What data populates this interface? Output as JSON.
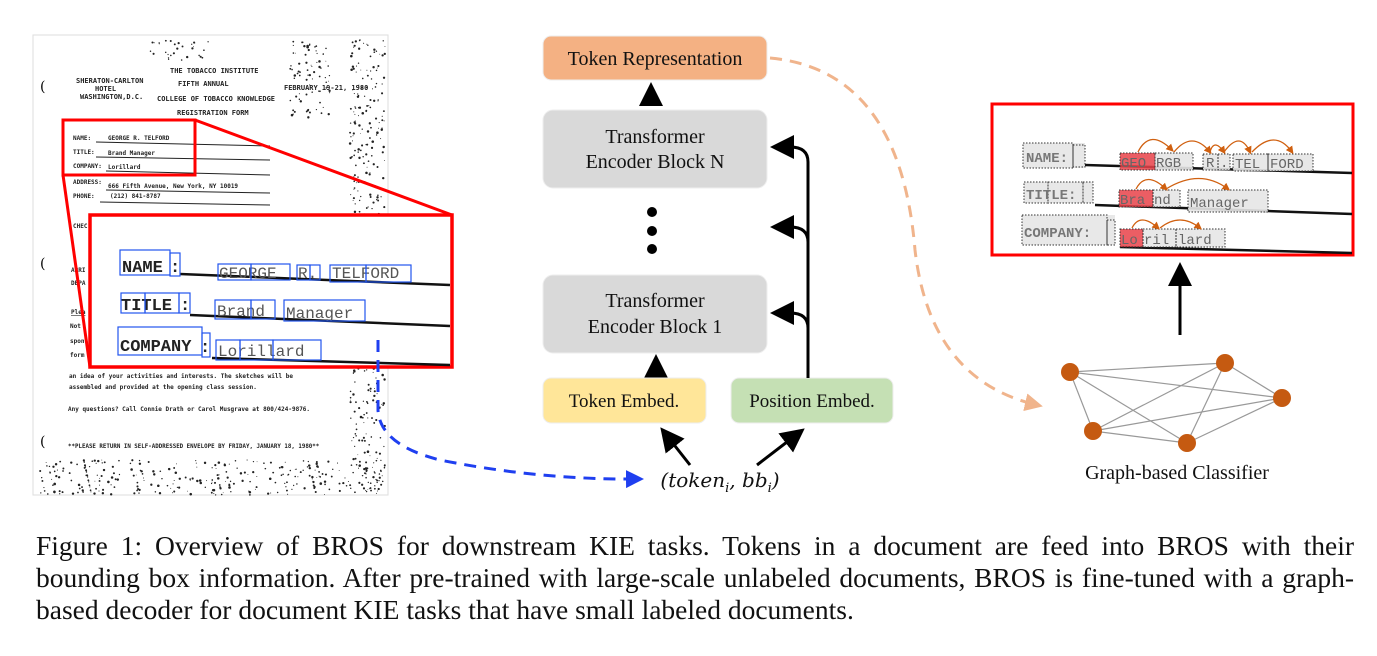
{
  "document_scan": {
    "header": [
      "THE TOBACCO INSTITUTE",
      "FIFTH ANNUAL",
      "COLLEGE OF TOBACCO KNOWLEDGE",
      "REGISTRATION FORM"
    ],
    "hotel": [
      "SHERATON-CARLTON",
      "HOTEL",
      "WASHINGTON,D.C."
    ],
    "date": "FEBRUARY 19-21, 1980",
    "fields": [
      {
        "label": "NAME:",
        "value": "GEORGE R. TELFORD"
      },
      {
        "label": "TITLE:",
        "value": "Brand Manager"
      },
      {
        "label": "COMPANY:",
        "value": "Lorillard"
      },
      {
        "label": "ADDRESS:",
        "value": "666 Fifth Avenue, New York, NY  10019"
      },
      {
        "label": "PHONE:",
        "value": "(212) 841-8787"
      }
    ],
    "fragments": [
      "CHEC",
      "ARRI",
      "DEPA",
      "Plea",
      "Not",
      "spon",
      "form"
    ],
    "body_lines": [
      "an idea of your activities and interests.  The sketches will be",
      "assembled and provided at the opening class session.",
      "Any questions?  Call Connie Drath or Carol Musgrave at 800/424-9876.",
      "**PLEASE RETURN IN SELF-ADDRESSED ENVELOPE BY FRIDAY, JANUARY 18, 1980**"
    ]
  },
  "zoom_inset": {
    "labels": [
      "NAME",
      ":",
      "TITLE",
      ":",
      "COMPANY",
      ":"
    ],
    "tokens": [
      "GEORGE",
      "R.",
      "TELFORD",
      "Brand",
      "Manager",
      "Lorillard"
    ],
    "box_color": "#2255ee",
    "frame_color": "#ff0000"
  },
  "model": {
    "token_representation": "Token Representation",
    "encoder_n": [
      "Transformer",
      "Encoder Block N"
    ],
    "encoder_1": [
      "Transformer",
      "Encoder Block 1"
    ],
    "token_embed": "Token Embed.",
    "position_embed": "Position Embed.",
    "input": {
      "token": "token",
      "bb": "bb",
      "sub": "i"
    },
    "colors": {
      "representation": "#f4b183",
      "encoder": "#d9d9d9",
      "token_embed": "#ffe699",
      "position_embed": "#c5e0b4"
    }
  },
  "classifier": {
    "label": "Graph-based Classifier",
    "node_color": "#c55a11",
    "highlight_color": "#e8434a",
    "rows": [
      {
        "label": "NAME:",
        "tokens": [
          "GEO",
          "RGB",
          "R",
          ".",
          "TEL",
          "FORD"
        ]
      },
      {
        "label": "TITLE:",
        "tokens": [
          "Bra",
          "nd",
          "Manager"
        ]
      },
      {
        "label": "COMPANY:",
        "tokens": [
          "Lo",
          "ril",
          "lard"
        ]
      }
    ]
  },
  "caption": "Figure 1: Overview of BROS for downstream KIE tasks. Tokens in a document are feed into BROS with their bounding box information. After pre-trained with large-scale unlabeled documents, BROS is fine-tuned with a graph-based decoder for document KIE tasks that have small labeled documents."
}
